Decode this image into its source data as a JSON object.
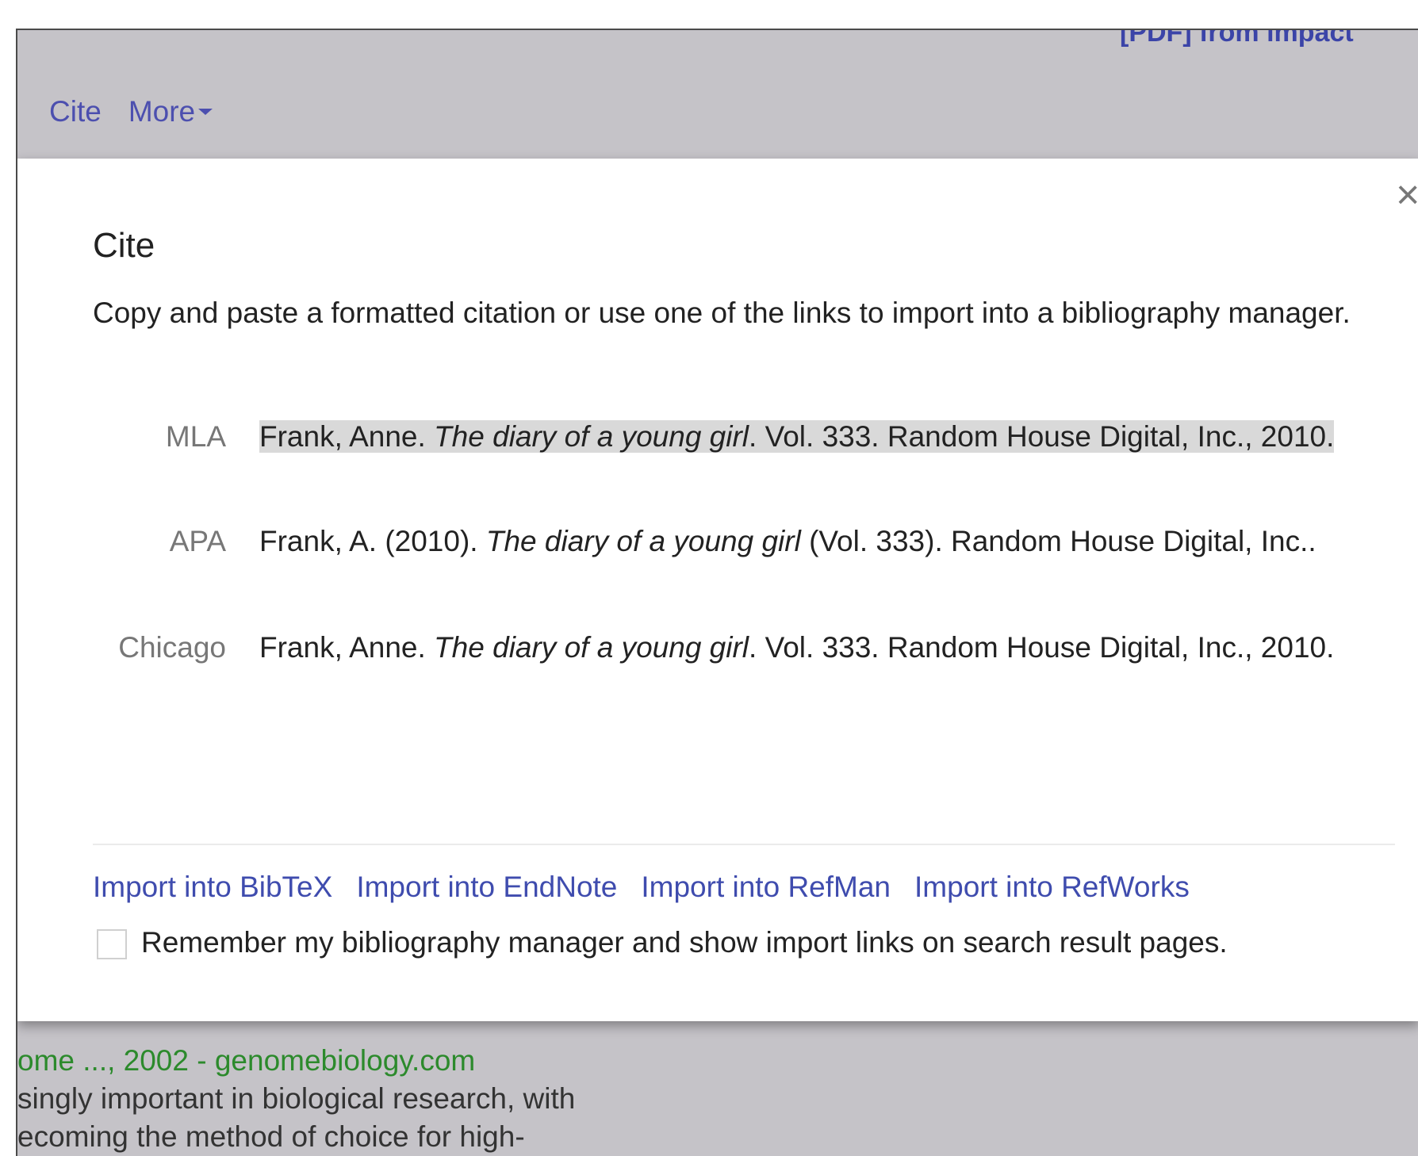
{
  "header": {
    "cutoff_text": "[PDF] from impact",
    "toolbar": [
      "Cite",
      "More"
    ]
  },
  "dialog": {
    "title": "Cite",
    "intro": "Copy and paste a formatted citation or use one of the links to import into a bibliography manager.",
    "close_symbol": "×",
    "citations": [
      {
        "label": "MLA",
        "before": "Frank, Anne. ",
        "italic": "The diary of a young girl",
        "after": ". Vol. 333. Random House Digital, Inc., 2010."
      },
      {
        "label": "APA",
        "before": "Frank, A. (2010). ",
        "italic": "The diary of a young girl",
        "after": " (Vol. 333). Random House Digital, Inc.."
      },
      {
        "label": "Chicago",
        "before": "Frank, Anne. ",
        "italic": "The diary of a young girl",
        "after": ". Vol. 333. Random House Digital, Inc., 2010."
      }
    ],
    "import_links": [
      "Import into BibTeX",
      "Import into EndNote",
      "Import into RefMan",
      "Import into RefWorks"
    ],
    "remember_label": "Remember my bibliography manager and show import links on search result pages."
  },
  "background_result": {
    "source_line": "ome ..., 2002 - genomebiology.com",
    "snippet_line1": "singly important in biological research, with",
    "snippet_line2": "ecoming the method of choice for high-"
  }
}
